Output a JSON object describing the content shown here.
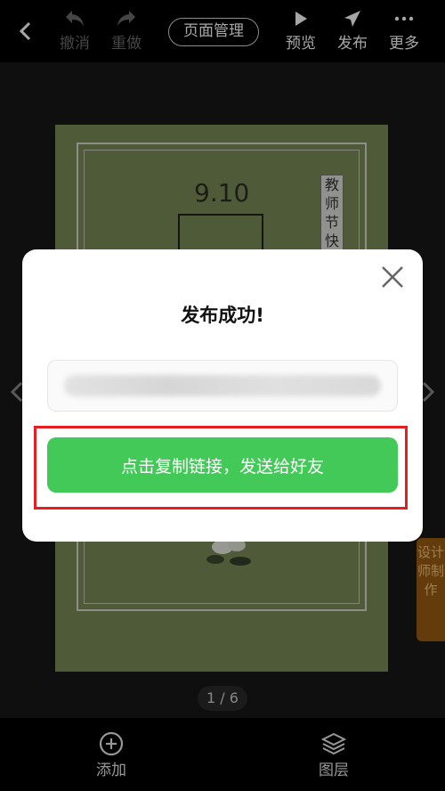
{
  "toolbar": {
    "undo_label": "撤消",
    "redo_label": "重做",
    "page_manage_label": "页面管理",
    "preview_label": "预览",
    "publish_label": "发布",
    "more_label": "更多"
  },
  "canvas": {
    "date_text": "9.10",
    "banner_text": "教师节快",
    "designer_tab": "设计师制作",
    "pager": "1 / 6"
  },
  "bottombar": {
    "add_label": "添加",
    "layers_label": "图层"
  },
  "dialog": {
    "title": "发布成功!",
    "copy_button_label": "点击复制链接，发送给好友"
  },
  "colors": {
    "accent_green": "#43c957",
    "highlight_red": "#e51f1f",
    "page_green": "#7a8c56",
    "designer_orange": "#9a5c11"
  },
  "icons": [
    "back-icon",
    "undo-icon",
    "redo-icon",
    "play-icon",
    "send-icon",
    "more-icon",
    "add-icon",
    "layers-icon",
    "close-icon"
  ]
}
